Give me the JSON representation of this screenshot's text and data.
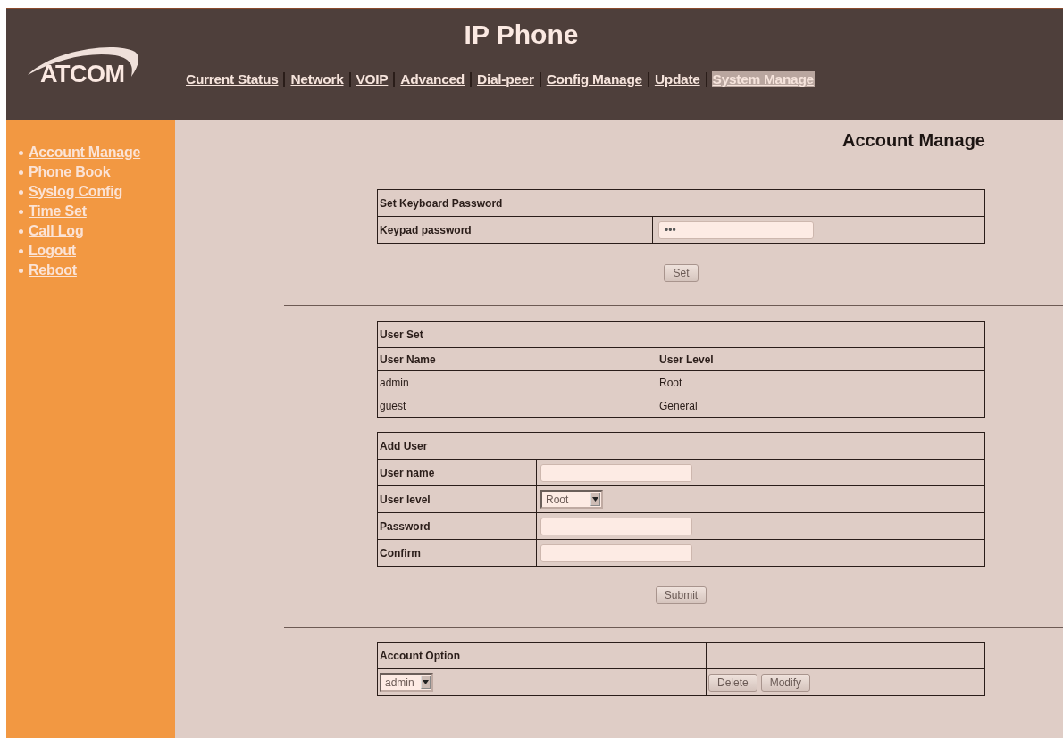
{
  "header": {
    "logo": "ATCOM",
    "title": "IP Phone"
  },
  "nav": [
    {
      "label": "Current Status",
      "selected": false
    },
    {
      "label": "Network",
      "selected": false
    },
    {
      "label": "VOIP",
      "selected": false
    },
    {
      "label": "Advanced",
      "selected": false
    },
    {
      "label": "Dial-peer",
      "selected": false
    },
    {
      "label": "Config Manage",
      "selected": false
    },
    {
      "label": "Update",
      "selected": false
    },
    {
      "label": "System Manage",
      "selected": true
    }
  ],
  "sidebar": {
    "items": [
      "Account Manage",
      "Phone Book",
      "Syslog Config",
      "Time Set",
      "Call Log",
      "Logout",
      "Reboot"
    ]
  },
  "page_title": "Account Manage",
  "keyboard_password": {
    "title": "Set Keyboard Password",
    "label": "Keypad password",
    "value": "•••",
    "button": "Set"
  },
  "user_set": {
    "title": "User Set",
    "columns": [
      "User Name",
      "User Level"
    ],
    "rows": [
      [
        "admin",
        "Root"
      ],
      [
        "guest",
        "General"
      ]
    ]
  },
  "add_user": {
    "title": "Add User",
    "fields": [
      {
        "label": "User name",
        "kind": "text"
      },
      {
        "label": "User level",
        "kind": "select",
        "value": "Root"
      },
      {
        "label": "Password",
        "kind": "text"
      },
      {
        "label": "Confirm",
        "kind": "text"
      }
    ],
    "button": "Submit"
  },
  "account_option": {
    "title": "Account Option",
    "select": "admin",
    "buttons": [
      "Delete",
      "Modify"
    ]
  }
}
